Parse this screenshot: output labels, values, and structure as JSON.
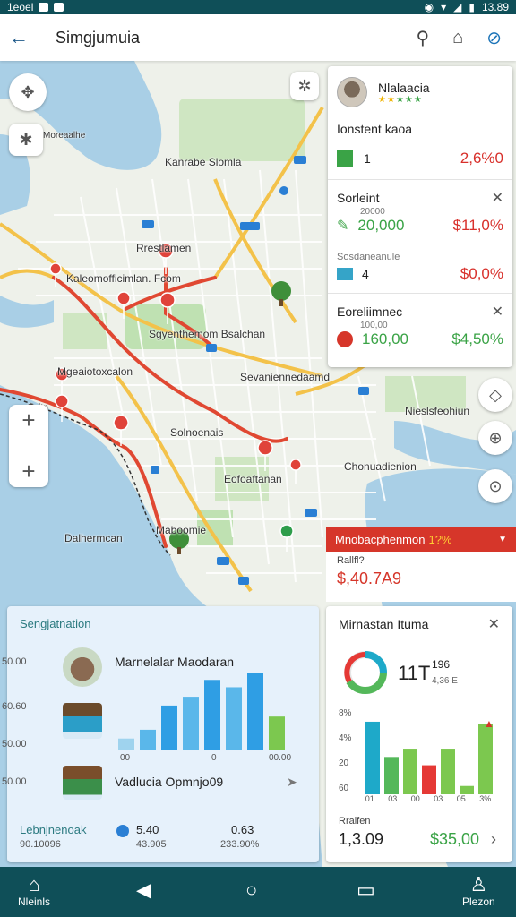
{
  "status_bar": {
    "left_text": "1eoel",
    "time": "13.89"
  },
  "app_bar": {
    "title": "Simgjumuia"
  },
  "map_labels": [
    "Kanrabe Slomla",
    "Rrestlamen",
    "Kaleomofficimlan. Fcom",
    "Sgyenthemom Bsalchan",
    "Mgeaiotoxcalon",
    "Sevaniennedaamd",
    "Solnoenais",
    "Eofoaftanan",
    "Maboomie",
    "Nieslsfeohiun",
    "Chonuadienion",
    "Dalhermcan",
    "Moreaalhe",
    "Gaitn"
  ],
  "info_panel": {
    "name": "Nlalaacia",
    "section_title": "Ionstent kaoa",
    "row1": {
      "value": "1",
      "change": "2,6%0"
    },
    "card1": {
      "title": "Sorleint",
      "sub": "20000",
      "value": "20,000",
      "change": "$11,0%"
    },
    "card2": {
      "title": "Sosdaneanule",
      "value": "4",
      "change": "$0,0%"
    },
    "card3": {
      "title": "Eoreliimnec",
      "sub": "100,00",
      "value": "160,00",
      "change": "$4,50%"
    }
  },
  "alert": {
    "text": "Mnobacphenmon",
    "pct": "1?%",
    "label": "Rallfl?",
    "value": "$,40.7A9"
  },
  "left_panel": {
    "title": "Sengjatnation",
    "y_ticks": [
      "50.00",
      "60.60",
      "50.00",
      "50.00"
    ],
    "item1": "Marnelalar Maodaran",
    "item2": "Vadlucia Opmnjo09",
    "x_ticks": [
      "00",
      "0",
      "00.00"
    ],
    "footer_label": "Lebnjnenoak",
    "footer_sub": "90.10096",
    "stat1": "5.40",
    "stat1_sub": "43.905",
    "stat2": "0.63",
    "stat2_sub": "233.90%"
  },
  "right_panel": {
    "title": "Mirnastan Ituma",
    "kpi": "11T",
    "kpi_small": "196",
    "kpi_sub": "4,36 E",
    "y_ticks": [
      "8%",
      "4%",
      "20",
      "60"
    ],
    "x_ticks": [
      "01",
      "03",
      "00",
      "03",
      "05",
      "3%"
    ],
    "footer_label": "Rraifen",
    "footer_value": "1,3.09",
    "footer_money": "$35,00"
  },
  "chart_data": [
    {
      "type": "bar",
      "values": [
        15,
        27,
        60,
        72,
        95,
        85,
        105,
        45
      ],
      "colors": [
        "#9fd3ee",
        "#5ab7ea",
        "#2f9ee4",
        "#5ab7ea",
        "#2f9ee4",
        "#5ab7ea",
        "#2f9ee4",
        "#7cc84f"
      ]
    },
    {
      "type": "bar",
      "values": [
        70,
        36,
        44,
        28,
        44,
        8,
        68
      ],
      "colors": [
        "#1ea9c9",
        "#54b85a",
        "#7cc84f",
        "#e53935",
        "#7cc84f",
        "#7cc84f",
        "#7cc84f"
      ]
    }
  ],
  "nav_bar": {
    "home_label": "Nleinls",
    "profile_label": "Plezon"
  }
}
